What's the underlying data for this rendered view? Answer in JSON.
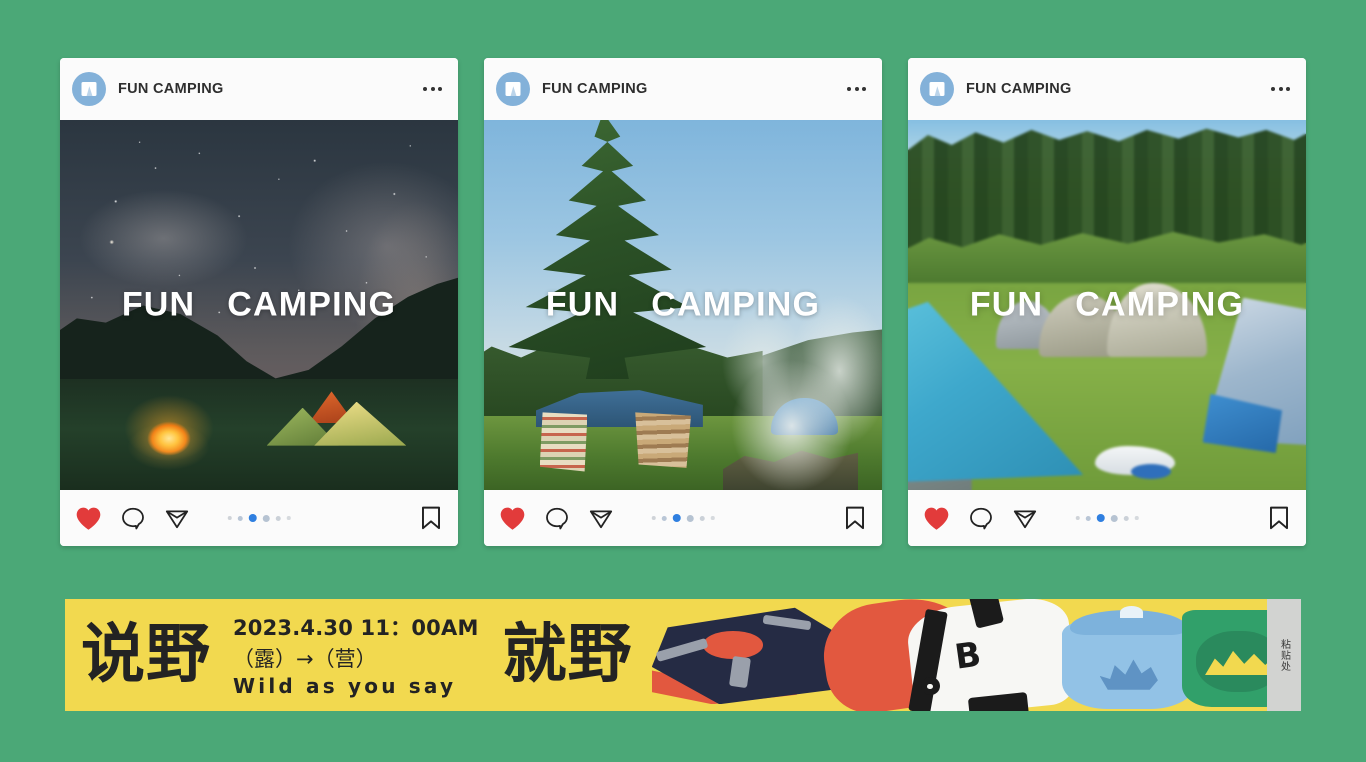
{
  "theme": {
    "background_green": "#4ba877",
    "card_background": "#fbfbfb",
    "banner_yellow": "#f2d94f",
    "banner_border_green": "#4ba877",
    "heart_red": "#e23b3b",
    "active_dot_blue": "#2f7fe0",
    "avatar_blue": "#83b1d9",
    "text_dark": "#232323"
  },
  "cards": [
    {
      "account_name": "FUN CAMPING",
      "avatar_icon": "tent-icon",
      "more_icon": "more-options-icon",
      "overlay_text": "FUN   CAMPING",
      "photo_alt": "night sky campsite with campfire and lit tents",
      "actions": {
        "like_icon": "heart-icon",
        "comment_icon": "comment-icon",
        "share_icon": "send-icon",
        "save_icon": "bookmark-icon"
      },
      "carousel": {
        "total": 6,
        "active_index": 2
      }
    },
    {
      "account_name": "FUN CAMPING",
      "avatar_icon": "tent-icon",
      "more_icon": "more-options-icon",
      "overlay_text": "FUN   CAMPING",
      "photo_alt": "daytime camp with conifer tree, tarp shelter and smoke",
      "actions": {
        "like_icon": "heart-icon",
        "comment_icon": "comment-icon",
        "share_icon": "send-icon",
        "save_icon": "bookmark-icon"
      },
      "carousel": {
        "total": 6,
        "active_index": 2
      }
    },
    {
      "account_name": "FUN CAMPING",
      "avatar_icon": "tent-icon",
      "more_icon": "more-options-icon",
      "overlay_text": "FUN   CAMPING",
      "photo_alt": "campground meadow with many tents and forest behind",
      "actions": {
        "like_icon": "heart-icon",
        "comment_icon": "comment-icon",
        "share_icon": "send-icon",
        "save_icon": "bookmark-icon"
      },
      "carousel": {
        "total": 6,
        "active_index": 2
      }
    }
  ],
  "banner": {
    "headline_left": "说野",
    "headline_right": "就野",
    "date_time": "2023.4.30 11：00AM",
    "subtitle_cn": "（露）→（营）",
    "subtitle_en": "Wild as you say",
    "bag_letter": "B",
    "paste_label": "粘贴处",
    "illustration_items": [
      "camping-stove-illustration",
      "duffel-bag-illustration",
      "kettle-illustration",
      "mug-illustration"
    ]
  }
}
